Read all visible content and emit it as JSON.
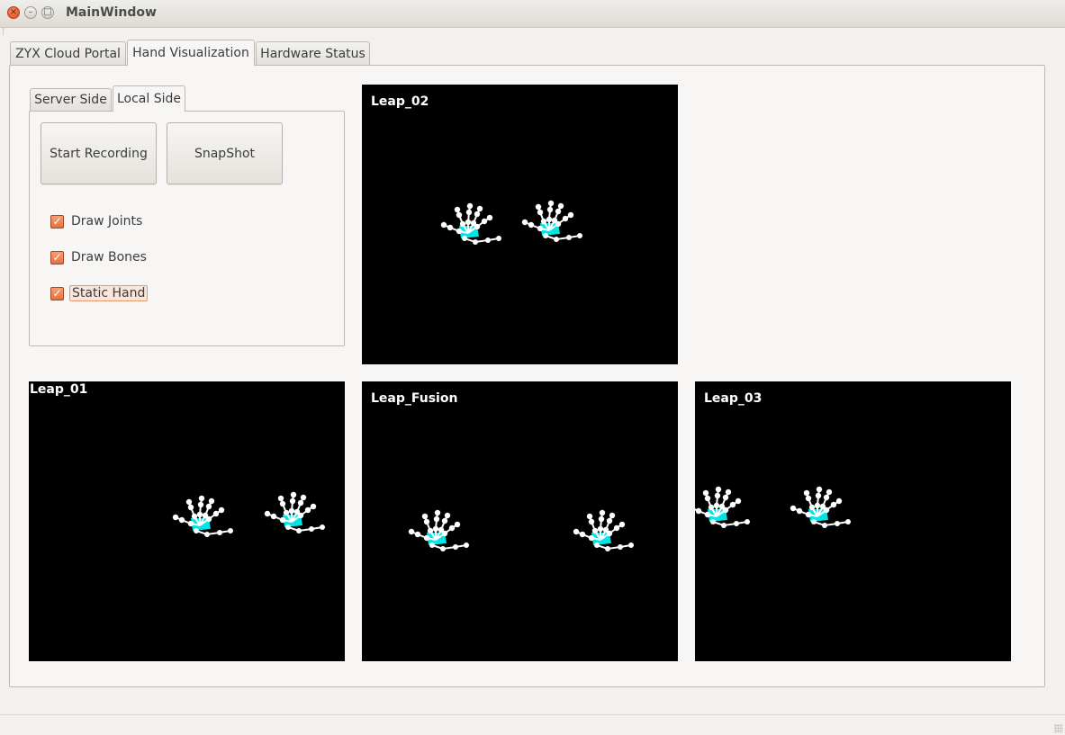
{
  "window": {
    "title": "MainWindow"
  },
  "main_tabs": [
    {
      "label": "ZYX Cloud Portal"
    },
    {
      "label": "Hand Visualization"
    },
    {
      "label": "Hardware Status"
    }
  ],
  "side_tabs": [
    {
      "label": "Server Side"
    },
    {
      "label": "Local Side"
    }
  ],
  "buttons": {
    "start_recording": "Start Recording",
    "snapshot": "SnapShot"
  },
  "options": [
    {
      "label": "Draw Joints",
      "checked": true
    },
    {
      "label": "Draw Bones",
      "checked": true
    },
    {
      "label": "Static Hand",
      "checked": true
    }
  ],
  "viewports": {
    "leap_02": "Leap_02",
    "leap_01": "Leap_01",
    "leap_fusion": "Leap_Fusion",
    "leap_03": "Leap_03"
  },
  "colors": {
    "palm": "#00e5e5",
    "joints": "#ffffff",
    "viewport_bg": "#000000",
    "checkbox": "#e2713f"
  }
}
